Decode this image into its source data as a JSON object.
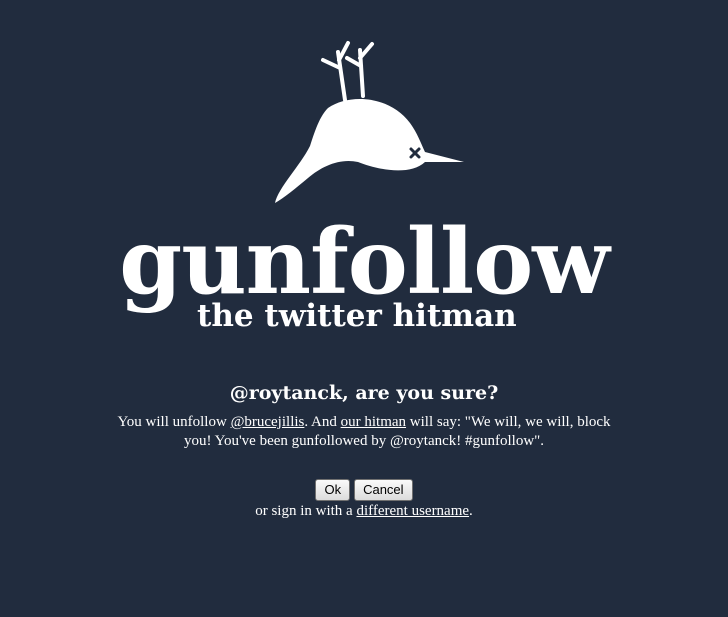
{
  "logo": {
    "title": "gunfollow",
    "tagline": "the twitter hitman",
    "icon": "dead-bird-icon"
  },
  "confirm": {
    "question": "@roytanck, are you sure?",
    "msg_prefix": "You will unfollow ",
    "target_user": "@brucejillis",
    "msg_middle": ". And ",
    "hitman_link": "our hitman",
    "msg_suffix": " will say: \"We will, we will, block you! You've been gunfollowed by @roytanck! #gunfollow\"."
  },
  "actions": {
    "ok_label": "Ok",
    "cancel_label": "Cancel"
  },
  "alt_signin": {
    "prefix": "or sign in with a ",
    "link": "different username",
    "suffix": "."
  },
  "colors": {
    "background": "#212c3e",
    "text": "#ffffff"
  }
}
